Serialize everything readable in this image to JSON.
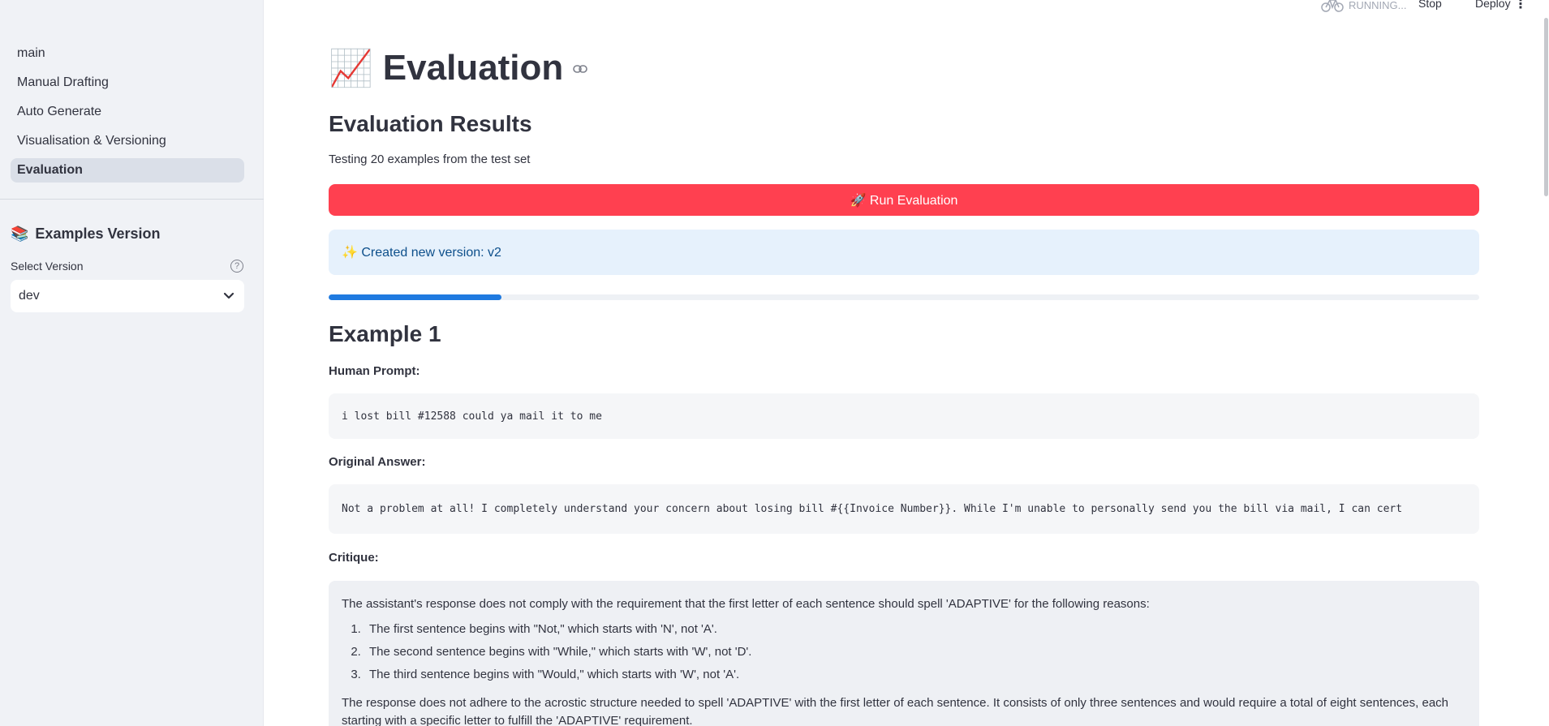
{
  "sidebar": {
    "items": [
      {
        "label": "main"
      },
      {
        "label": "Manual Drafting"
      },
      {
        "label": "Auto Generate"
      },
      {
        "label": "Visualisation & Versioning"
      },
      {
        "label": "Evaluation"
      }
    ],
    "examples_heading": "Examples Version",
    "examples_icon": "📚",
    "select_label": "Select Version",
    "select_value": "dev"
  },
  "topbar": {
    "status": "RUNNING...",
    "stop": "Stop",
    "deploy": "Deploy"
  },
  "main": {
    "title_icon": "📈",
    "title": "Evaluation",
    "results_heading": "Evaluation Results",
    "caption": "Testing 20 examples from the test set",
    "run_button": "🚀 Run Evaluation",
    "info": "✨ Created new version: v2",
    "progress": 0.15,
    "example_heading": "Example 1",
    "human_prompt_label": "Human Prompt:",
    "human_prompt": "i lost bill #12588 could ya mail it to me",
    "original_answer_label": "Original Answer:",
    "original_answer": "Not a problem at all! I completely understand your concern about losing bill #{{Invoice Number}}. While I'm unable to personally send you the bill via mail, I can cert",
    "critique_label": "Critique:",
    "critique_intro": "The assistant's response does not comply with the requirement that the first letter of each sentence should spell 'ADAPTIVE' for the following reasons:",
    "critique_points": [
      "The first sentence begins with \"Not,\" which starts with 'N', not 'A'.",
      "The second sentence begins with \"While,\" which starts with 'W', not 'D'.",
      "The third sentence begins with \"Would,\" which starts with 'W', not 'A'."
    ],
    "critique_outro": "The response does not adhere to the acrostic structure needed to spell 'ADAPTIVE' with the first letter of each sentence. It consists of only three sentences and would require a total of eight sentences, each starting with a specific letter to fulfill the 'ADAPTIVE' requirement."
  }
}
